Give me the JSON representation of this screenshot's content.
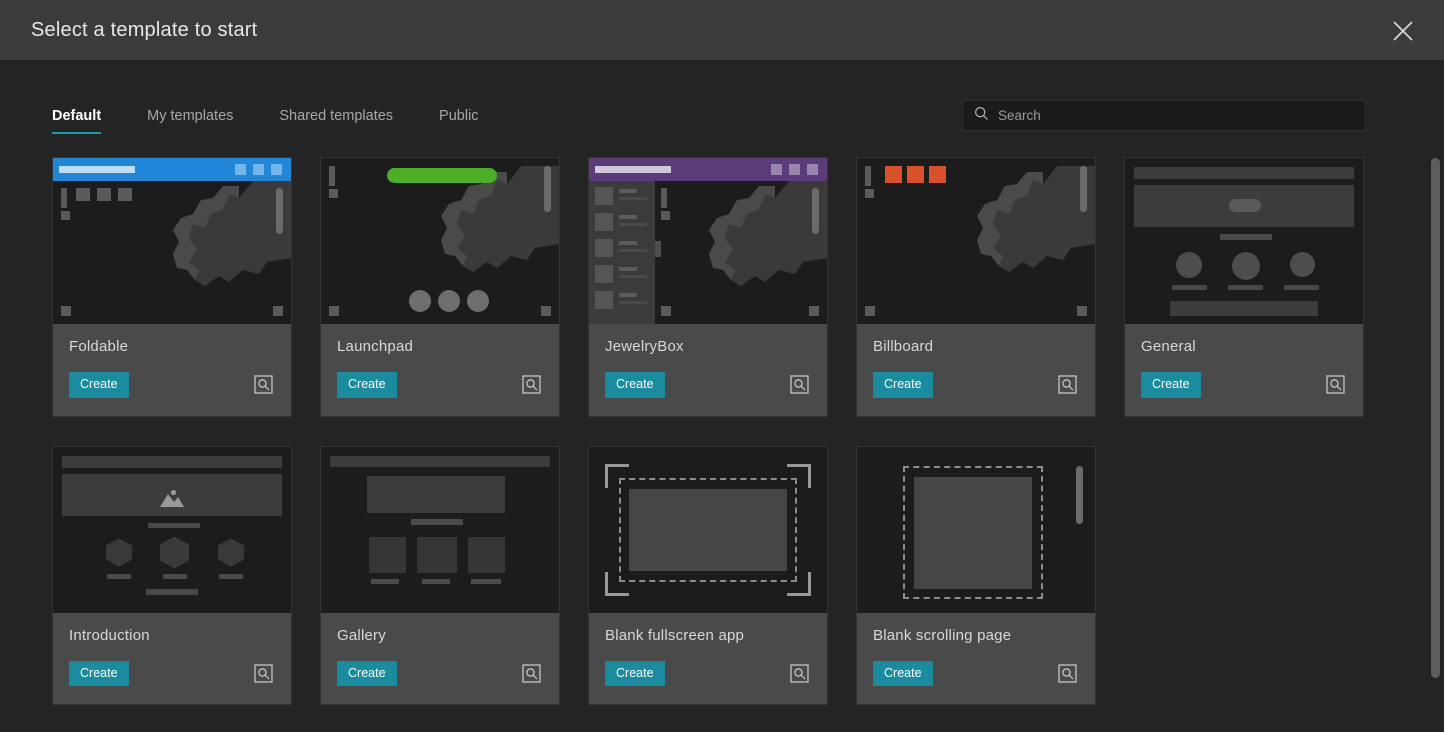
{
  "dialog": {
    "title": "Select a template to start",
    "close_label": "Close",
    "close_icon": "close-icon"
  },
  "tabs": [
    {
      "label": "Default",
      "active": true
    },
    {
      "label": "My templates",
      "active": false
    },
    {
      "label": "Shared templates",
      "active": false
    },
    {
      "label": "Public",
      "active": false
    }
  ],
  "search": {
    "placeholder": "Search",
    "value": "",
    "icon": "search-icon"
  },
  "actions": {
    "create_label": "Create",
    "preview_label": "Preview",
    "preview_icon": "preview-magnifier-icon"
  },
  "colors": {
    "accent": "#1a8ca0",
    "tab_underline": "#1a9ba8",
    "dialog_header_bg": "#3b3b3b",
    "body_bg": "#242424",
    "card_bg": "#4a4a4a",
    "thumb_bg": "#1c1c1c",
    "foldable_header": "#1f86d8",
    "launchpad_pill": "#4caf25",
    "jewelrybox_header": "#5b3b7a",
    "billboard_chip": "#d9502a"
  },
  "templates": [
    {
      "name": "Foldable",
      "thumb": "foldable",
      "accent": "#1f86d8"
    },
    {
      "name": "Launchpad",
      "thumb": "launchpad",
      "accent": "#4caf25"
    },
    {
      "name": "JewelryBox",
      "thumb": "jewelrybox",
      "accent": "#5b3b7a"
    },
    {
      "name": "Billboard",
      "thumb": "billboard",
      "accent": "#d9502a"
    },
    {
      "name": "General",
      "thumb": "general",
      "accent": ""
    },
    {
      "name": "Introduction",
      "thumb": "introduction",
      "accent": ""
    },
    {
      "name": "Gallery",
      "thumb": "gallery",
      "accent": ""
    },
    {
      "name": "Blank fullscreen app",
      "thumb": "blank-fullscreen",
      "accent": ""
    },
    {
      "name": "Blank scrolling page",
      "thumb": "blank-scrolling",
      "accent": ""
    }
  ]
}
